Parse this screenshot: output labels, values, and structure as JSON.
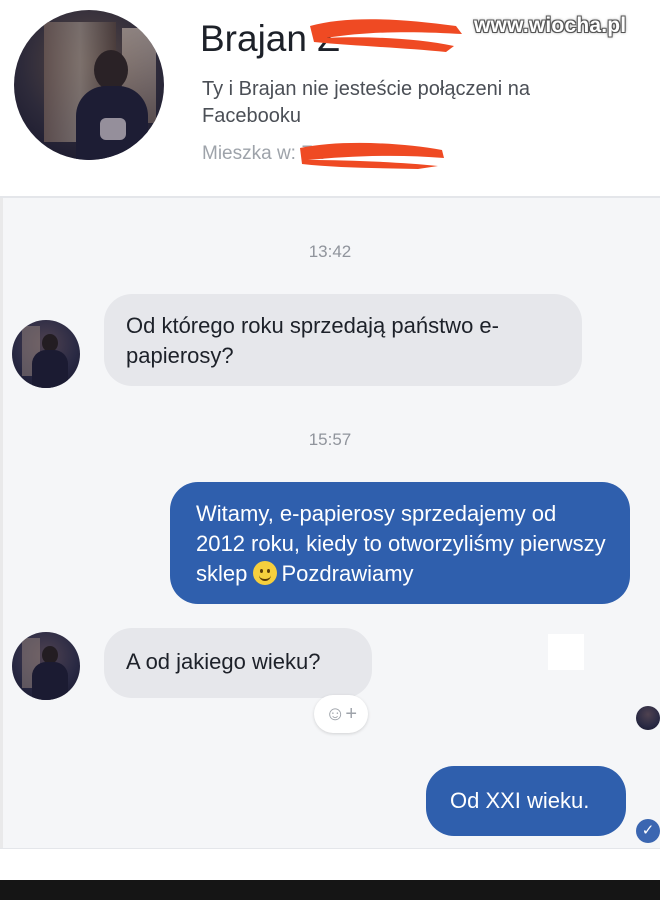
{
  "header": {
    "contact_name": "Brajan Z",
    "connection_note": "Ty i Brajan nie jesteście połączeni na Facebooku",
    "location": "Mieszka w: Za",
    "redaction_color": "#ef4a23"
  },
  "watermark": "www.wiocha.pl",
  "messages": [
    {
      "type": "timestamp",
      "text": "13:42"
    },
    {
      "type": "incoming",
      "text": "Od którego roku sprzedają państwo e-papierosy?"
    },
    {
      "type": "timestamp",
      "text": "15:57"
    },
    {
      "type": "outgoing",
      "text_before_emoji": "Witamy, e-papierosy sprzedajemy od 2012 roku, kiedy to otworzyliśmy pierwszy sklep",
      "emoji": "smiling-face-emoji",
      "text_after_emoji": "Pozdrawiamy"
    },
    {
      "type": "incoming",
      "text": "A od jakiego wieku?"
    },
    {
      "type": "outgoing",
      "text": "Od XXI wieku."
    }
  ],
  "reaction_button": {
    "icon": "add-reaction-icon",
    "label": "☺+"
  },
  "colors": {
    "outgoing_bubble": "#2f5fad",
    "incoming_bubble": "#e6e7eb",
    "background": "#f5f6f8"
  }
}
